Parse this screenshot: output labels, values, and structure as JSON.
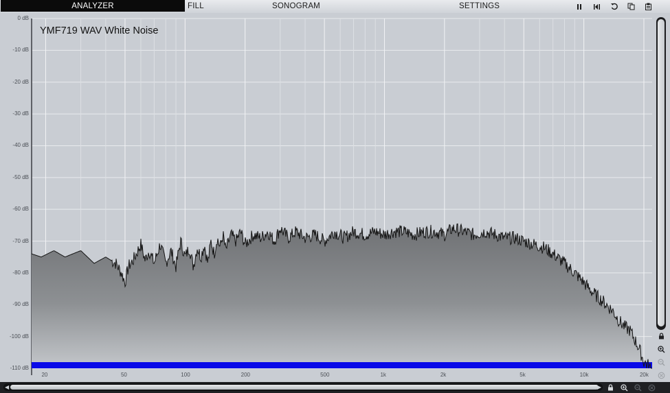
{
  "menu": {
    "tabs": [
      "ANALYZER",
      "FILL",
      "SONOGRAM",
      "SETTINGS"
    ],
    "toolbar_icons": [
      "pause-icon",
      "reset-peak-icon",
      "undo-icon",
      "copy-icon",
      "paste-icon"
    ]
  },
  "overlay_title": "YMF719 WAV White Noise",
  "side_icons": [
    "lock-icon",
    "zoom-in-icon",
    "zoom-out-icon",
    "zoom-reset-icon"
  ],
  "bottom_icons": [
    "lock-icon",
    "zoom-in-icon",
    "zoom-out-icon",
    "zoom-reset-icon"
  ],
  "colors": {
    "plot_background": "#c9cdd3",
    "spectrum_line": "#141414",
    "peak_bar": "#0a0ae8",
    "active_tab": "#0b0b0b"
  },
  "chart_data": {
    "type": "area",
    "x_scale": "log",
    "xlim": [
      17,
      22000
    ],
    "ylim": [
      -110,
      0
    ],
    "grid": true,
    "y_ticks": [
      "0 dB",
      "-10 dB",
      "-20 dB",
      "-30 dB",
      "-40 dB",
      "-50 dB",
      "-60 dB",
      "-70 dB",
      "-80 dB",
      "-90 dB",
      "-100 dB",
      "-110 dB"
    ],
    "x_ticks": [
      "20",
      "50",
      "100",
      "200",
      "500",
      "1k",
      "2k",
      "5k",
      "10k",
      "20k"
    ],
    "x_tick_values": [
      20,
      50,
      100,
      200,
      500,
      1000,
      2000,
      5000,
      10000,
      20000
    ],
    "series": [
      {
        "x": [
          17,
          19,
          22,
          25,
          30,
          35,
          40,
          45,
          48,
          50,
          52,
          55,
          60,
          63,
          66,
          70,
          75,
          80,
          85,
          90,
          95,
          100,
          105,
          110,
          115,
          120,
          125,
          130,
          135,
          140,
          145,
          150,
          155,
          160,
          170,
          180,
          190,
          200,
          220,
          240,
          260,
          280,
          300,
          330,
          360,
          400,
          450,
          500,
          560,
          630,
          700,
          800,
          900,
          1000,
          1100,
          1250,
          1400,
          1600,
          1800,
          2000,
          2200,
          2500,
          2800,
          3200,
          3600,
          4000,
          4500,
          5000,
          5600,
          6300,
          7000,
          8000,
          9000,
          10000,
          11000,
          12500,
          14000,
          15000,
          16000,
          17000,
          18000,
          19000,
          20000,
          21000,
          22000
        ],
        "y": [
          -74,
          -75,
          -73,
          -75,
          -73,
          -77,
          -75,
          -77,
          -80,
          -83,
          -78,
          -76,
          -71,
          -76,
          -73,
          -77,
          -71,
          -77,
          -73,
          -78,
          -70,
          -75,
          -72,
          -78,
          -72,
          -75,
          -71,
          -77,
          -70,
          -74,
          -69,
          -72,
          -68,
          -73,
          -68,
          -70,
          -67,
          -71,
          -68,
          -69,
          -67,
          -70,
          -66,
          -69,
          -67,
          -69,
          -68,
          -70,
          -67,
          -69,
          -67,
          -68,
          -67,
          -68,
          -67,
          -67,
          -68,
          -67,
          -67,
          -68,
          -66,
          -67,
          -68,
          -67,
          -68,
          -69,
          -69,
          -70,
          -71,
          -72,
          -74,
          -77,
          -80,
          -83,
          -86,
          -89,
          -92,
          -95,
          -97,
          -98,
          -101,
          -104,
          -108,
          -109,
          -111
        ]
      }
    ]
  }
}
